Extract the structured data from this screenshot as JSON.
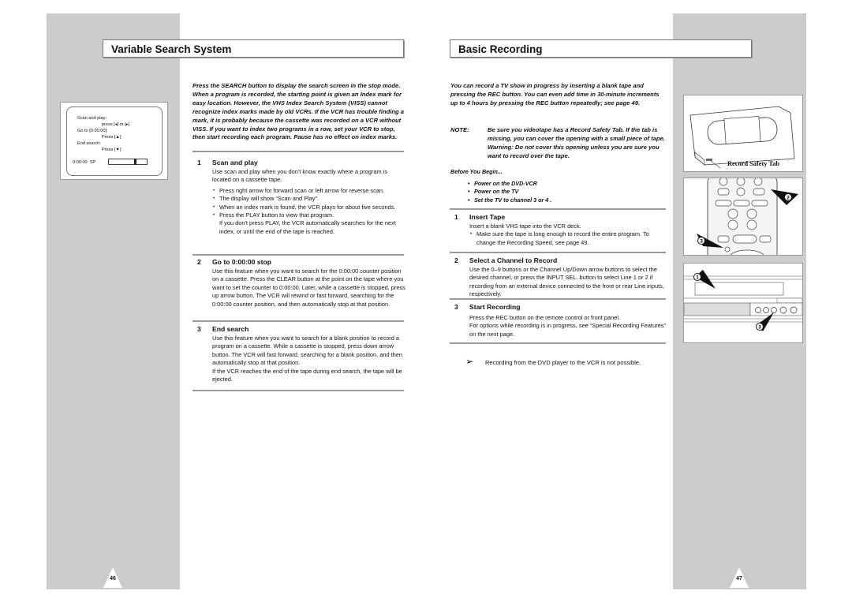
{
  "left_page": {
    "title": "Variable Search System",
    "page_number": "46",
    "osd": {
      "line1": "Scan and play:",
      "line2": "press [◂] or [▸]",
      "line3": "Go to [0:00:00]:",
      "line4": "Press [▲]",
      "line5": "End search:",
      "line6": "Press [▼]",
      "counter": "0:00:00",
      "speed": "SP",
      "tape_position": 0.72
    },
    "intro": "Press the SEARCH button to display the search screen in the stop mode. When a program is recorded, the starting point is given an Index mark for easy location. However, the VHS Index Search System (VISS) cannot recognize index marks made by old VCRs. If the VCR has trouble finding a mark, it is probably because the cassette was recorded on a VCR without VISS. If you want to index two programs in a row, set your VCR to stop, then start recording each program. Pause has no effect on index marks.",
    "steps": [
      {
        "num": "1",
        "heading": "Scan and play",
        "text": "Use scan and play when you don't know exactly where a program is located on a cassette tape.",
        "bullets": [
          "Press right arrow for forward scan or left arrow for reverse scan.",
          "The display will show “Scan and Play”.",
          "When an index mark is found, the VCR plays for about five seconds.",
          "Press the PLAY button to view that program."
        ],
        "after": "If you don't press PLAY, the VCR automatically searches for the next index, or until the end of the tape is reached."
      },
      {
        "num": "2",
        "heading": "Go to 0:00:00 stop",
        "text": "Use this feature when you want to search for the 0:00:00 counter position on a cassette. Press the CLEAR button at the point on the tape where you want to set the counter to 0:00:00. Later, while a cassette is stopped, press up arrow button. The VCR will rewind or fast forward, searching for the 0:00:00 counter position, and then automatically stop at that position."
      },
      {
        "num": "3",
        "heading": "End search",
        "text": "Use this feature when you want to search for a blank position to record a program on a cassette. While a cassette is stopped, press down arrow button. The VCR will fast forward, searching for a blank position, and then automatically stop at that position.",
        "after": "If the VCR reaches the end of the tape during end search, the tape will be ejected."
      }
    ]
  },
  "right_page": {
    "title": "Basic Recording",
    "page_number": "47",
    "intro": "You can record a TV show in progress by inserting a blank tape and pressing the REC button. You can even add time in 30-minute increments up to 4 hours by pressing the REC button repeatedly; see page 49.",
    "note_label": "NOTE:",
    "note_text": "Be sure you videotape has a Record Safety Tab. If the tab is missing, you can cover the opening with a small piece of tape. Warning: Do not cover this opening unless you are sure you want to record over the tape.",
    "before_heading": "Before You Begin...",
    "before_items": [
      "Power on the DVD-VCR",
      "Power on the TV",
      "Set the TV to channel 3 or 4 ."
    ],
    "steps": [
      {
        "num": "1",
        "heading": "Insert Tape",
        "text": "Insert a blank VHS tape into the VCR deck.",
        "bullets": [
          "Make sure the tape is long enough to record the entire program. To change the Recording Speed, see page 49."
        ]
      },
      {
        "num": "2",
        "heading": "Select a Channel to Record",
        "text": "Use the 0–9 buttons or the Channel Up/Down arrow buttons to select the desired channel, or press the INPUT SEL. button to select Line 1 or 2 if recording from an external device connected to the front or rear Line inputs, respectively."
      },
      {
        "num": "3",
        "heading": "Start Recording",
        "text": "Press the REC button on the remote control or front panel.",
        "after": "For options while recording is in progress, see “Special Recording Features” on the next page."
      }
    ],
    "tip": "Recording from the DVD player to the VCR is not possible.",
    "illustrations": {
      "cassette_caption": "Record Safety Tab",
      "remote_callouts": [
        "2",
        "3"
      ],
      "deck_callouts": [
        "1",
        "3"
      ]
    }
  }
}
